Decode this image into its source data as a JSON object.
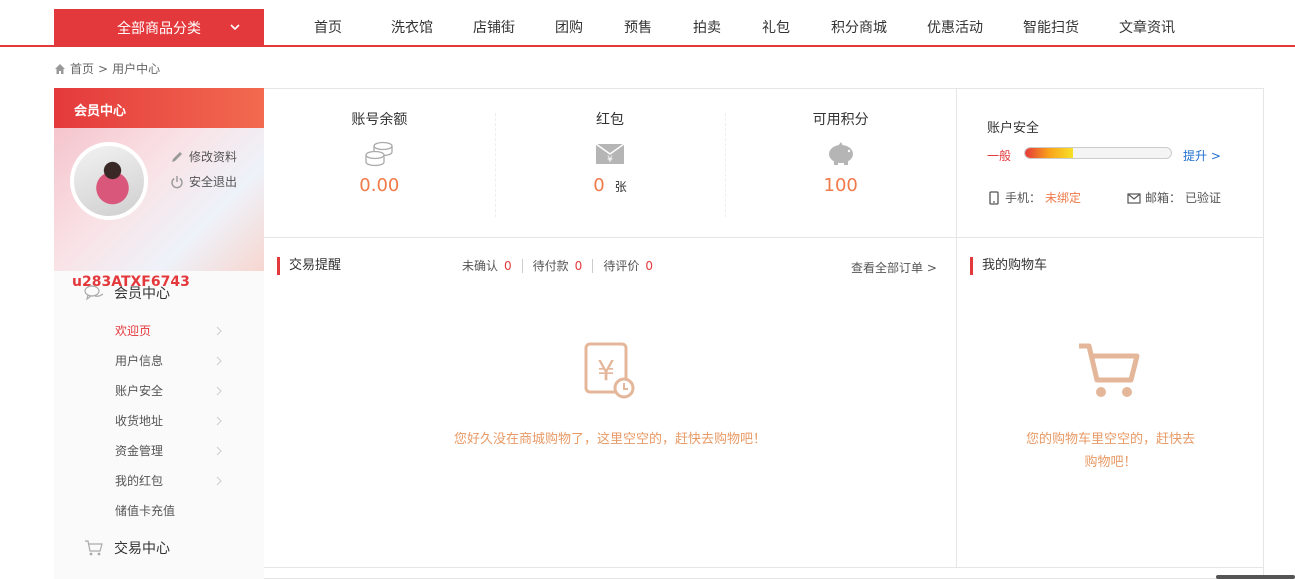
{
  "nav": {
    "category_label": "全部商品分类",
    "items": [
      "首页",
      "洗衣馆",
      "店铺街",
      "团购",
      "预售",
      "拍卖",
      "礼包",
      "积分商城",
      "优惠活动",
      "智能扫货",
      "文章资讯"
    ]
  },
  "breadcrumb": {
    "home": "首页",
    "separator": ">",
    "current": "用户中心"
  },
  "sidebar": {
    "header": "会员中心",
    "edit_profile": "修改资料",
    "logout": "安全退出",
    "username": "u283ATXF6743",
    "member_group": {
      "title": "会员中心",
      "items": [
        {
          "label": "欢迎页"
        },
        {
          "label": "用户信息"
        },
        {
          "label": "账户安全"
        },
        {
          "label": "收货地址"
        },
        {
          "label": "资金管理"
        },
        {
          "label": "我的红包"
        },
        {
          "label": "储值卡充值"
        }
      ]
    },
    "trade_group": {
      "title": "交易中心"
    }
  },
  "stats": {
    "balance": {
      "label": "账号余额",
      "value": "0.00"
    },
    "redpacket": {
      "label": "红包",
      "value": "0",
      "unit": "张"
    },
    "points": {
      "label": "可用积分",
      "value": "100"
    }
  },
  "security": {
    "title": "账户安全",
    "level": "一般",
    "level_fraction": 0.33,
    "upgrade": "提升 >",
    "phone_label": "手机：",
    "phone_status": "未绑定",
    "email_label": "邮箱：",
    "email_status": "已验证"
  },
  "trade": {
    "title": "交易提醒",
    "unconfirmed_label": "未确认",
    "unconfirmed_count": "0",
    "unpaid_label": "待付款",
    "unpaid_count": "0",
    "unreviewed_label": "待评价",
    "unreviewed_count": "0",
    "view_all": "查看全部订单 >",
    "empty_text": "您好久没在商城购物了，这里空空的，赶快去购物吧！"
  },
  "cart": {
    "title": "我的购物车",
    "empty_line1": "您的购物车里空空的，赶快去",
    "empty_line2": "购物吧！"
  },
  "colors": {
    "accent": "#e4393c",
    "highlight": "#f07a4a",
    "link": "#1d6fd0"
  }
}
